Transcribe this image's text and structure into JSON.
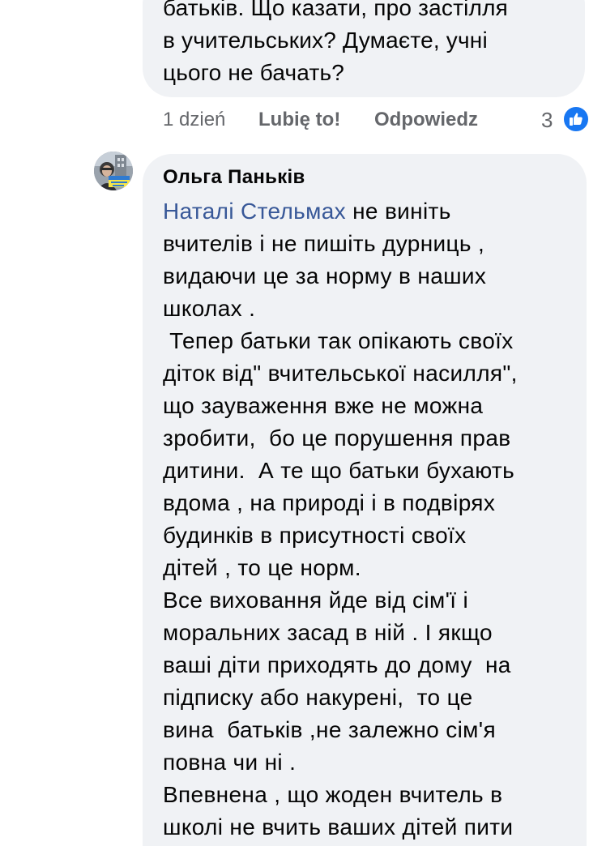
{
  "previous_comment": {
    "lines": [
      "батьків. Що казати, про застілля",
      "в учительських? Думаєте, учні",
      "цього не бачать?"
    ],
    "time": "1 dzień",
    "like_label": "Lubię to!",
    "reply_label": "Odpowiedz",
    "reaction_count": "3",
    "reaction_icon": "thumbs-up-icon"
  },
  "comment": {
    "author": "Ольга Паньків",
    "mention": "Наталі Стельмах",
    "first_line_rest": " не виніть",
    "lines": [
      "вчителів і не пишіть дурниць ,",
      "видаючи це за норму в наших",
      "школах .",
      " Тепер батьки так опікають своїх",
      "діток від\" вчительської насилля\",",
      "що зауваження вже не можна",
      "зробити,  бо це порушення прав",
      "дитини.  А те що батьки бухають",
      "вдома , на природі і в подвірях",
      "будинків в присутності своїх",
      "дітей , то це норм.",
      "Все виховання йде від сім'ї і",
      "моральних засад в ній . І якщо",
      "ваші діти приходять до дому  на",
      "підписку або накурені,  то це",
      "вина  батьків ,не залежно сім'я",
      "повна чи ні .",
      "Впевнена , що жоден вчитель в",
      "школі не вчить ваших дітей пити"
    ]
  },
  "colors": {
    "bubble": "#f0f2f5",
    "text": "#050505",
    "secondary": "#65676b",
    "mention": "#385898",
    "like_badge": "#1877f2"
  }
}
